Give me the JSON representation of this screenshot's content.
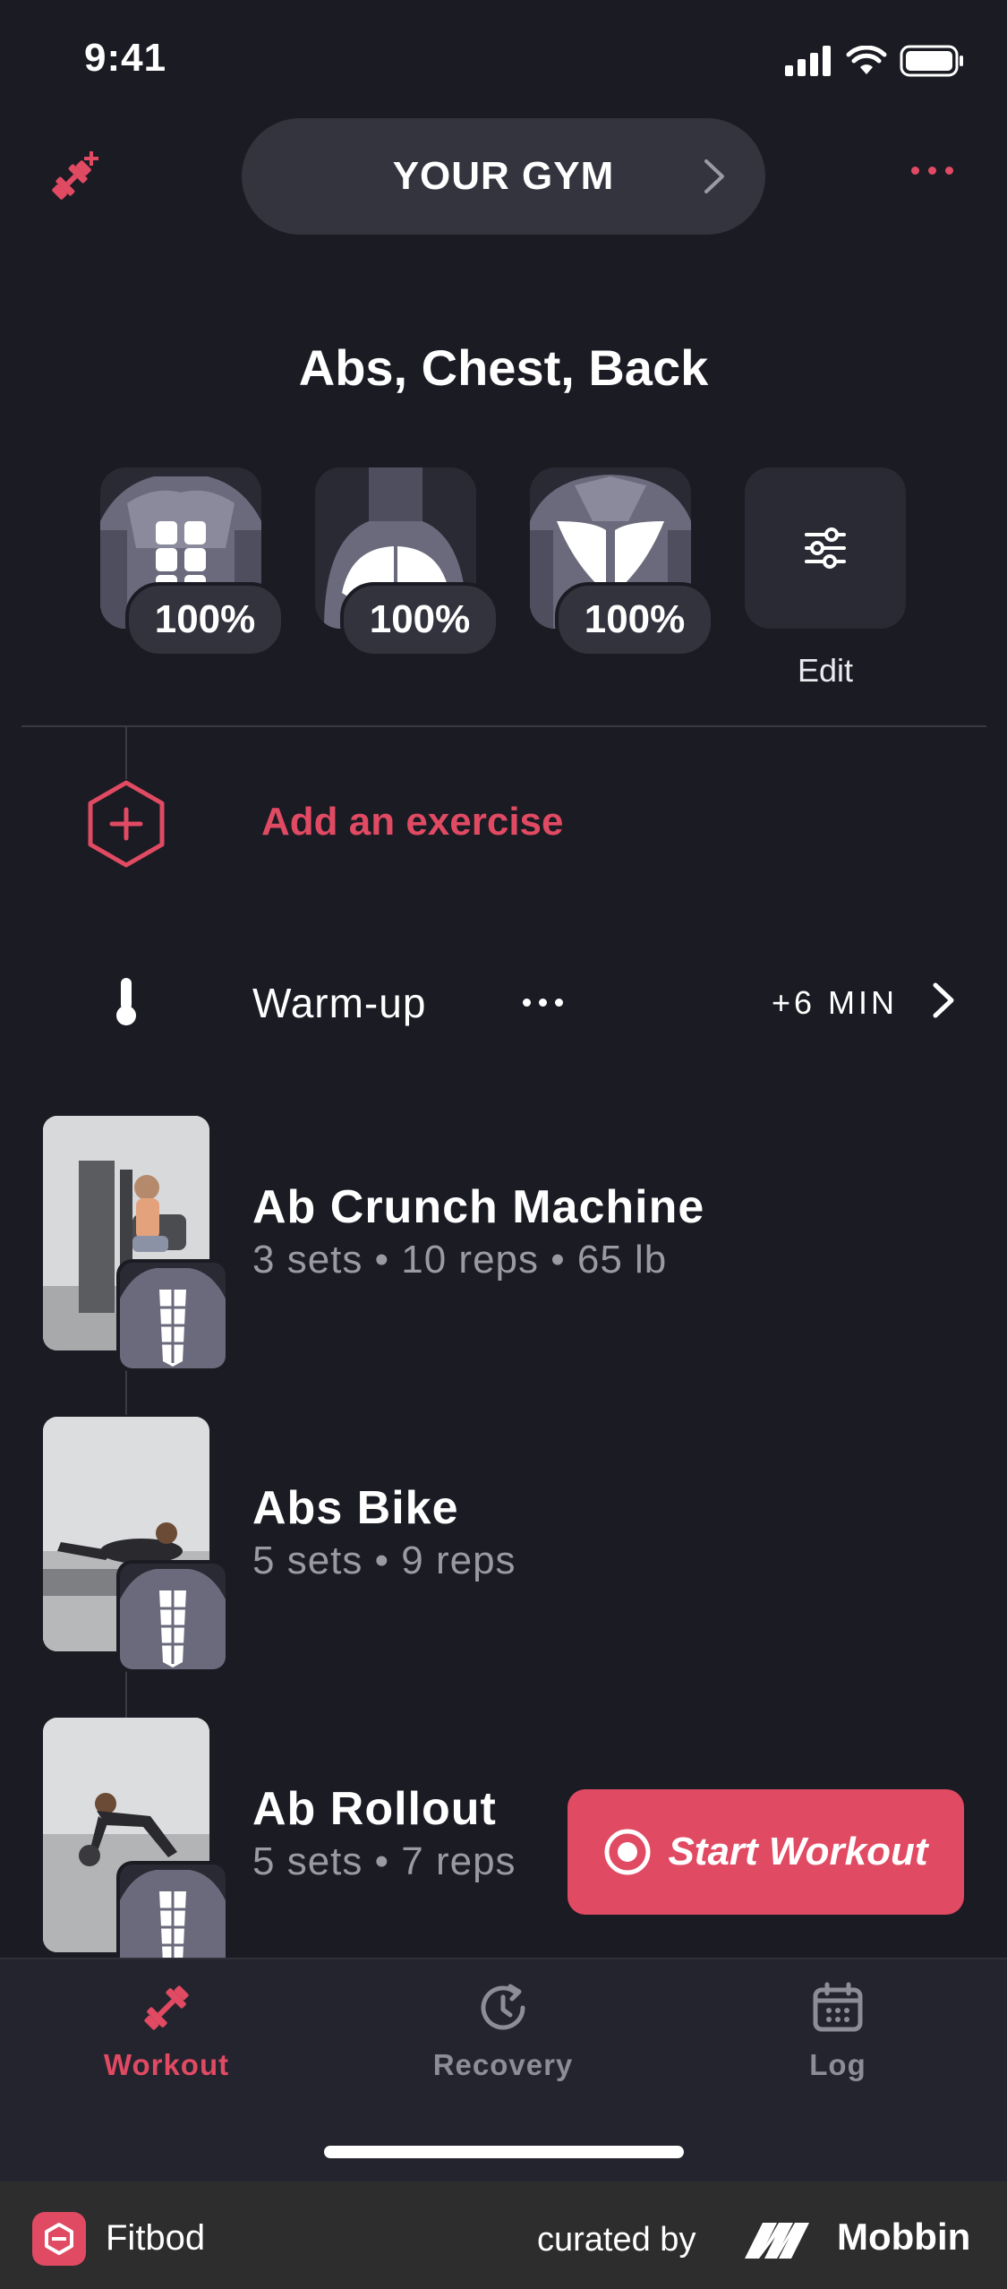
{
  "status_bar": {
    "time": "9:41"
  },
  "header": {
    "gym_label": "YOUR GYM",
    "muscle_groups_title": "Abs, Chest, Back"
  },
  "muscles": [
    {
      "name": "abs",
      "percent": "100%"
    },
    {
      "name": "chest",
      "percent": "100%"
    },
    {
      "name": "back",
      "percent": "100%"
    }
  ],
  "edit_label": "Edit",
  "add_exercise_label": "Add an exercise",
  "warmup": {
    "label": "Warm-up",
    "time": "+6 MIN"
  },
  "exercises": [
    {
      "name": "Ab Crunch Machine",
      "detail": "3 sets • 10 reps • 65 lb"
    },
    {
      "name": "Abs Bike",
      "detail": "5 sets • 9 reps"
    },
    {
      "name": "Ab Rollout",
      "detail": "5 sets • 7 reps"
    }
  ],
  "start_button_label": "Start Workout",
  "tabs": [
    {
      "label": "Workout",
      "active": true
    },
    {
      "label": "Recovery",
      "active": false
    },
    {
      "label": "Log",
      "active": false
    }
  ],
  "footer": {
    "app_name": "Fitbod",
    "curated_by": "curated by",
    "brand": "Mobbin"
  },
  "colors": {
    "accent": "#e14a63",
    "background": "#1b1b24",
    "card": "#2a2a35"
  }
}
